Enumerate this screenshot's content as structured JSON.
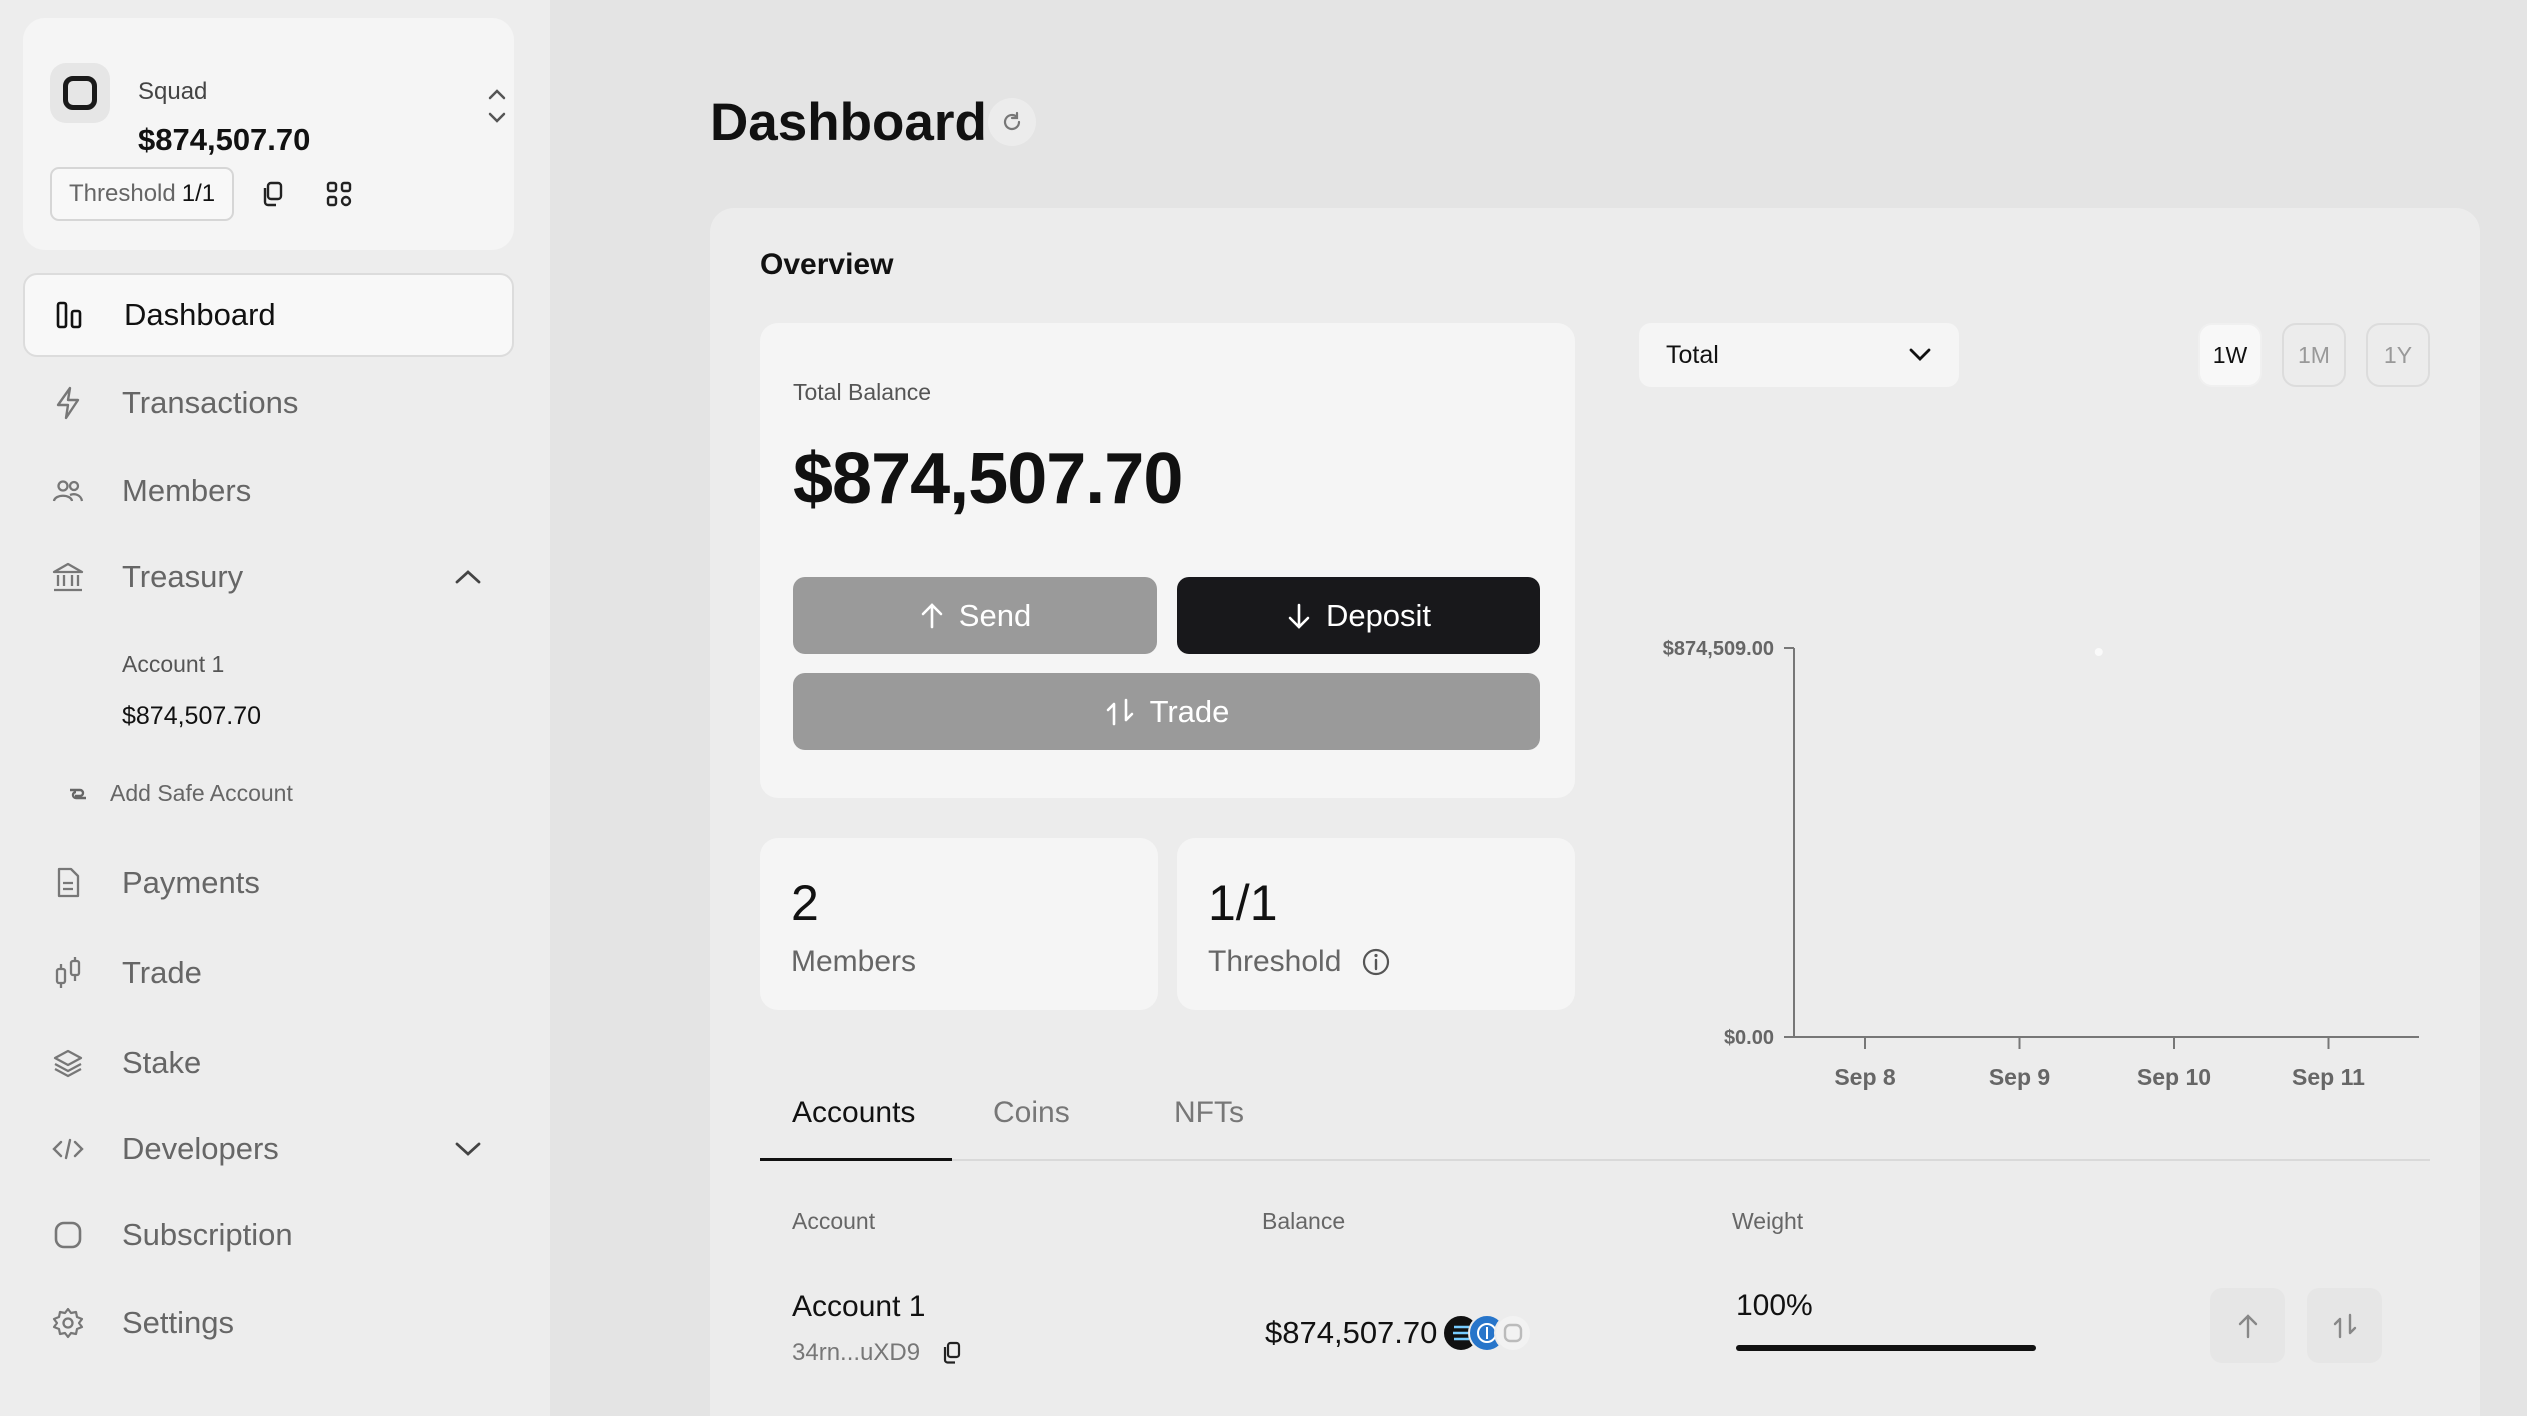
{
  "squad": {
    "name": "Squad",
    "balance": "$874,507.70",
    "threshold_label": "Threshold",
    "threshold_value": "1/1"
  },
  "nav": {
    "dashboard": "Dashboard",
    "transactions": "Transactions",
    "members": "Members",
    "treasury": "Treasury",
    "treasury_account_name": "Account 1",
    "treasury_account_balance": "$874,507.70",
    "add_safe_account": "Add Safe Account",
    "payments": "Payments",
    "trade": "Trade",
    "stake": "Stake",
    "developers": "Developers",
    "subscription": "Subscription",
    "settings": "Settings"
  },
  "page": {
    "title": "Dashboard"
  },
  "overview": {
    "title": "Overview",
    "total_balance_label": "Total Balance",
    "total_balance": "$874,507.70",
    "send_label": "Send",
    "deposit_label": "Deposit",
    "trade_label": "Trade",
    "members_count": "2",
    "members_label": "Members",
    "threshold_value": "1/1",
    "threshold_label": "Threshold"
  },
  "chart_controls": {
    "selected": "Total",
    "ranges": [
      "1W",
      "1M",
      "1Y"
    ],
    "active_range": "1W"
  },
  "chart_data": {
    "type": "line",
    "x": [
      "Sep 8",
      "Sep 9",
      "Sep 10",
      "Sep 11"
    ],
    "y_ticks": [
      "$874,509.00",
      "$0.00"
    ],
    "ylim": [
      0,
      874509.0
    ],
    "series": [
      {
        "values": [
          null,
          null,
          874507.7,
          null
        ]
      }
    ],
    "grid": false
  },
  "tabs": [
    "Accounts",
    "Coins",
    "NFTs"
  ],
  "table": {
    "headers": {
      "account": "Account",
      "balance": "Balance",
      "weight": "Weight"
    },
    "rows": [
      {
        "name": "Account 1",
        "address": "34rn...uXD9",
        "balance": "$874,507.70",
        "weight": "100%",
        "weight_fraction": 1.0
      }
    ]
  },
  "colors": {
    "primary_button": "#18181b",
    "muted_button": "#9a9a9a",
    "accent_usdc": "#2775ca"
  }
}
